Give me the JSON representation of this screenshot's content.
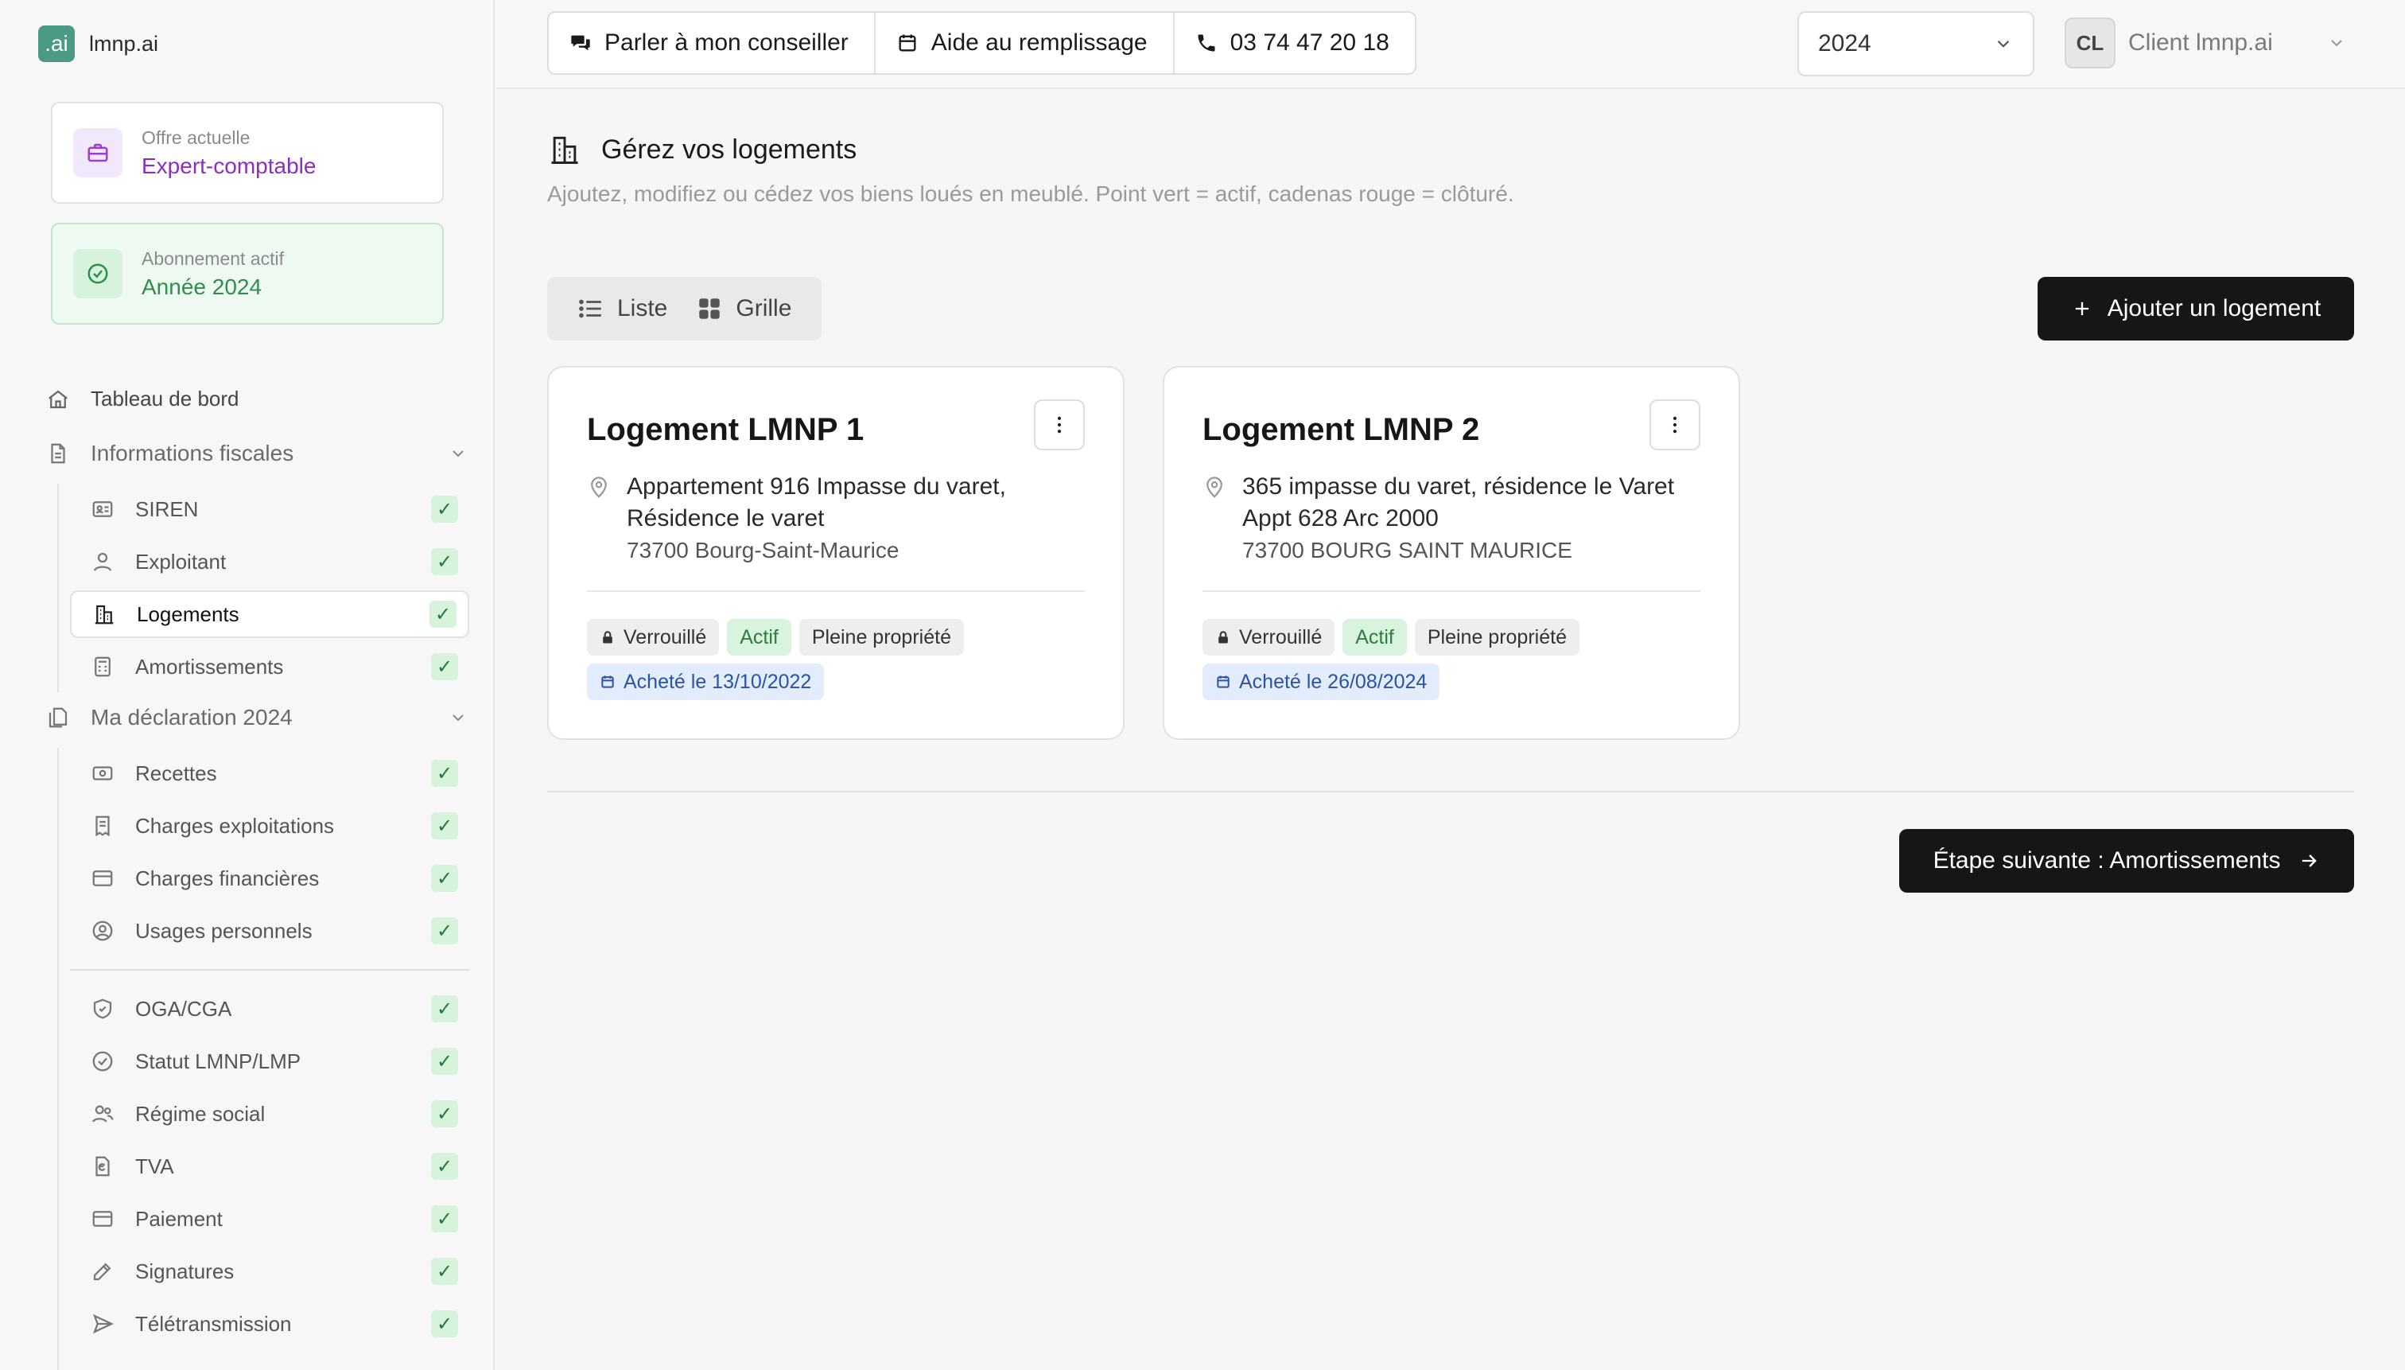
{
  "brand": {
    "logo_text": ".ai",
    "name": "lmnp.ai"
  },
  "offers": {
    "current": {
      "label": "Offre actuelle",
      "value": "Expert-comptable"
    },
    "subscription": {
      "label": "Abonnement actif",
      "value": "Année 2024"
    }
  },
  "nav": {
    "dashboard": "Tableau de bord",
    "fiscal_section": "Informations fiscales",
    "fiscal_items": [
      {
        "label": "SIREN",
        "check": "✓"
      },
      {
        "label": "Exploitant",
        "check": "✓"
      },
      {
        "label": "Logements",
        "check": "✓"
      },
      {
        "label": "Amortissements",
        "check": "✓"
      }
    ],
    "declaration_section": "Ma déclaration 2024",
    "declaration_items": [
      {
        "label": "Recettes",
        "check": "✓"
      },
      {
        "label": "Charges exploitations",
        "check": "✓"
      },
      {
        "label": "Charges financières",
        "check": "✓"
      },
      {
        "label": "Usages personnels",
        "check": "✓"
      }
    ],
    "more_items": [
      {
        "label": "OGA/CGA",
        "check": "✓"
      },
      {
        "label": "Statut LMNP/LMP",
        "check": "✓"
      },
      {
        "label": "Régime social",
        "check": "✓"
      },
      {
        "label": "TVA",
        "check": "✓"
      },
      {
        "label": "Paiement",
        "check": "✓"
      },
      {
        "label": "Signatures",
        "check": "✓"
      },
      {
        "label": "Télétransmission",
        "check": "✓"
      }
    ]
  },
  "topbar": {
    "advisor_label": "Parler à mon conseiller",
    "help_label": "Aide au remplissage",
    "phone": "03 74 47 20 18",
    "year": "2024",
    "user_initials": "CL",
    "user_name": "Client lmnp.ai"
  },
  "main": {
    "title": "Gérez vos logements",
    "description": "Ajoutez, modifiez ou cédez vos biens loués en meublé. Point vert = actif, cadenas rouge = clôturé.",
    "view_list": "Liste",
    "view_grid": "Grille",
    "add_button": "Ajouter un logement",
    "next_button": "Étape suivante : Amortissements",
    "properties": [
      {
        "title": "Logement LMNP 1",
        "address_line1": "Appartement 916 Impasse du varet,",
        "address_line2": "Résidence le varet",
        "address_line3": "73700 Bourg-Saint-Maurice",
        "tag_locked": "Verrouillé",
        "tag_status": "Actif",
        "tag_ownership": "Pleine propriété",
        "purchase": "Acheté le 13/10/2022"
      },
      {
        "title": "Logement LMNP 2",
        "address_line1": "365 impasse du varet, résidence le Varet",
        "address_line2": "Appt 628 Arc 2000",
        "address_line3": "73700 BOURG SAINT MAURICE",
        "tag_locked": "Verrouillé",
        "tag_status": "Actif",
        "tag_ownership": "Pleine propriété",
        "purchase": "Acheté le 26/08/2024"
      }
    ]
  },
  "colors": {
    "accent_dark": "#161616",
    "purple": "#8a2fbf",
    "green": "#2f8f4a",
    "check_bg": "#d8f3dc",
    "brand": "#4a9a86"
  }
}
